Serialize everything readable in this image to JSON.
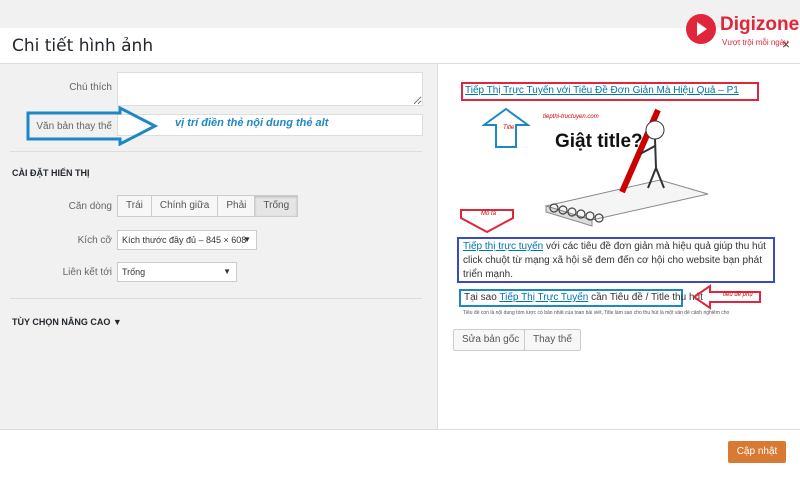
{
  "dialog": {
    "title": "Chi tiết hình ảnh",
    "close": "×"
  },
  "logo": {
    "brand": "Digizone",
    "tagline": "Vượt trội mỗi ngày"
  },
  "left": {
    "caption_label": "Chú thích",
    "alt_label": "Văn bản thay thế",
    "alt_annotation": "vị trí điền thẻ nội dung thẻ alt",
    "display_settings": "CÀI ĐẶT HIỂN THỊ",
    "align_label": "Căn dòng",
    "align_options": [
      "Trái",
      "Chính giữa",
      "Phải",
      "Trống"
    ],
    "size_label": "Kích cỡ",
    "size_value": "Kích thước đầy đủ – 845 × 608",
    "link_label": "Liên kết tới",
    "link_value": "Trống",
    "advanced": "TÙY CHỌN NÂNG CAO ▼"
  },
  "preview": {
    "title_text": "Tiếp Thị Trực Tuyến với Tiêu Đề Đơn Giản Mà Hiệu Quả – P1",
    "title_tag": "Title",
    "site_url": "tiepthi-tructuyen.com",
    "image_text": "Giật title?",
    "desc_tag": "Mô tả",
    "desc_link": "Tiếp thị trực tuyến",
    "desc_rest": " với các tiêu đề đơn giản mà hiệu quả giúp thu hút click chuột từ mạng xã hội sẽ đem đến cơ hội cho website bạn phát triển mạnh.",
    "sub_prefix": "Tại sao ",
    "sub_link": "Tiếp Thị Trực Tuyến",
    "sub_rest": " cần Tiêu đề / Title thu hút",
    "sub_tag": "tiêu đề phụ",
    "small_text": "Tiêu đề con là nội dung tóm lược có bản nhất của toan bài viết, Title làm sao cho thu hút là một vấn đề cảnh nghiêm cho",
    "edit_original": "Sửa bản gốc",
    "replace": "Thay thế"
  },
  "footer": {
    "update": "Cập nhật"
  },
  "colors": {
    "accent_blue": "#1e88c7",
    "red": "#e0263a",
    "orange": "#d87a33"
  }
}
